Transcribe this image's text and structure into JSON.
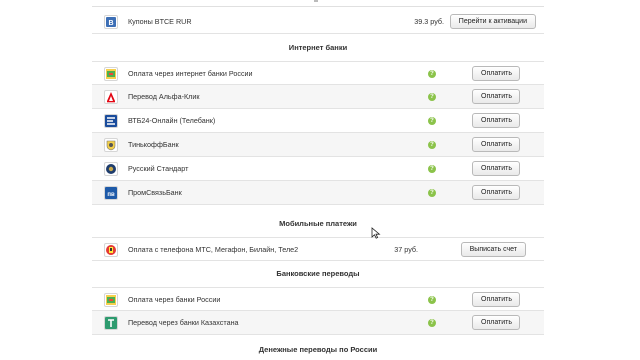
{
  "coupons": {
    "label": "Купоны BTCE RUR",
    "price": "39.3 руб.",
    "button": "Перейти к активации",
    "icon": "btce-icon"
  },
  "sections": {
    "internet_banks": "Интернет банки",
    "mobile_payments": "Мобильные платежи",
    "bank_transfers": "Банковские переводы",
    "money_transfers_russia": "Денежные переводы по России"
  },
  "internet_banks": [
    {
      "label": "Оплата через интернет банки России",
      "button": "Оплатить",
      "icon": "russia-banks-icon"
    },
    {
      "label": "Перевод Альфа-Клик",
      "button": "Оплатить",
      "icon": "alfa-bank-icon"
    },
    {
      "label": "ВТБ24-Онлайн (Телебанк)",
      "button": "Оплатить",
      "icon": "vtb24-icon"
    },
    {
      "label": "ТинькоффБанк",
      "button": "Оплатить",
      "icon": "tinkoff-icon"
    },
    {
      "label": "Русский Стандарт",
      "button": "Оплатить",
      "icon": "russian-standard-icon"
    },
    {
      "label": "ПромСвязьБанк",
      "button": "Оплатить",
      "icon": "psb-icon"
    }
  ],
  "mobile": {
    "label": "Оплата с телефона МТС, Мегафон, Билайн, Теле2",
    "price": "37 руб.",
    "button": "Выписать счет",
    "icon": "mobile-operators-icon"
  },
  "bank_transfers": [
    {
      "label": "Оплата через банки России",
      "button": "Оплатить",
      "icon": "russia-banks-icon"
    },
    {
      "label": "Перевод через банки Казахстана",
      "button": "Оплатить",
      "icon": "kazakhstan-bank-icon"
    }
  ],
  "help_glyph": "?",
  "colors": {
    "help_green": "#8bc34a",
    "row_border": "#e3e3e3"
  }
}
